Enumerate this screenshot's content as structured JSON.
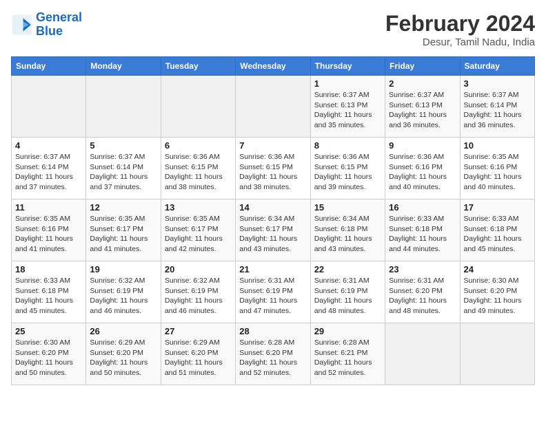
{
  "header": {
    "logo_line1": "General",
    "logo_line2": "Blue",
    "month_year": "February 2024",
    "location": "Desur, Tamil Nadu, India"
  },
  "columns": [
    "Sunday",
    "Monday",
    "Tuesday",
    "Wednesday",
    "Thursday",
    "Friday",
    "Saturday"
  ],
  "weeks": [
    [
      {
        "day": "",
        "info": ""
      },
      {
        "day": "",
        "info": ""
      },
      {
        "day": "",
        "info": ""
      },
      {
        "day": "",
        "info": ""
      },
      {
        "day": "1",
        "info": "Sunrise: 6:37 AM\nSunset: 6:13 PM\nDaylight: 11 hours\nand 35 minutes."
      },
      {
        "day": "2",
        "info": "Sunrise: 6:37 AM\nSunset: 6:13 PM\nDaylight: 11 hours\nand 36 minutes."
      },
      {
        "day": "3",
        "info": "Sunrise: 6:37 AM\nSunset: 6:14 PM\nDaylight: 11 hours\nand 36 minutes."
      }
    ],
    [
      {
        "day": "4",
        "info": "Sunrise: 6:37 AM\nSunset: 6:14 PM\nDaylight: 11 hours\nand 37 minutes."
      },
      {
        "day": "5",
        "info": "Sunrise: 6:37 AM\nSunset: 6:14 PM\nDaylight: 11 hours\nand 37 minutes."
      },
      {
        "day": "6",
        "info": "Sunrise: 6:36 AM\nSunset: 6:15 PM\nDaylight: 11 hours\nand 38 minutes."
      },
      {
        "day": "7",
        "info": "Sunrise: 6:36 AM\nSunset: 6:15 PM\nDaylight: 11 hours\nand 38 minutes."
      },
      {
        "day": "8",
        "info": "Sunrise: 6:36 AM\nSunset: 6:15 PM\nDaylight: 11 hours\nand 39 minutes."
      },
      {
        "day": "9",
        "info": "Sunrise: 6:36 AM\nSunset: 6:16 PM\nDaylight: 11 hours\nand 40 minutes."
      },
      {
        "day": "10",
        "info": "Sunrise: 6:35 AM\nSunset: 6:16 PM\nDaylight: 11 hours\nand 40 minutes."
      }
    ],
    [
      {
        "day": "11",
        "info": "Sunrise: 6:35 AM\nSunset: 6:16 PM\nDaylight: 11 hours\nand 41 minutes."
      },
      {
        "day": "12",
        "info": "Sunrise: 6:35 AM\nSunset: 6:17 PM\nDaylight: 11 hours\nand 41 minutes."
      },
      {
        "day": "13",
        "info": "Sunrise: 6:35 AM\nSunset: 6:17 PM\nDaylight: 11 hours\nand 42 minutes."
      },
      {
        "day": "14",
        "info": "Sunrise: 6:34 AM\nSunset: 6:17 PM\nDaylight: 11 hours\nand 43 minutes."
      },
      {
        "day": "15",
        "info": "Sunrise: 6:34 AM\nSunset: 6:18 PM\nDaylight: 11 hours\nand 43 minutes."
      },
      {
        "day": "16",
        "info": "Sunrise: 6:33 AM\nSunset: 6:18 PM\nDaylight: 11 hours\nand 44 minutes."
      },
      {
        "day": "17",
        "info": "Sunrise: 6:33 AM\nSunset: 6:18 PM\nDaylight: 11 hours\nand 45 minutes."
      }
    ],
    [
      {
        "day": "18",
        "info": "Sunrise: 6:33 AM\nSunset: 6:18 PM\nDaylight: 11 hours\nand 45 minutes."
      },
      {
        "day": "19",
        "info": "Sunrise: 6:32 AM\nSunset: 6:19 PM\nDaylight: 11 hours\nand 46 minutes."
      },
      {
        "day": "20",
        "info": "Sunrise: 6:32 AM\nSunset: 6:19 PM\nDaylight: 11 hours\nand 46 minutes."
      },
      {
        "day": "21",
        "info": "Sunrise: 6:31 AM\nSunset: 6:19 PM\nDaylight: 11 hours\nand 47 minutes."
      },
      {
        "day": "22",
        "info": "Sunrise: 6:31 AM\nSunset: 6:19 PM\nDaylight: 11 hours\nand 48 minutes."
      },
      {
        "day": "23",
        "info": "Sunrise: 6:31 AM\nSunset: 6:20 PM\nDaylight: 11 hours\nand 48 minutes."
      },
      {
        "day": "24",
        "info": "Sunrise: 6:30 AM\nSunset: 6:20 PM\nDaylight: 11 hours\nand 49 minutes."
      }
    ],
    [
      {
        "day": "25",
        "info": "Sunrise: 6:30 AM\nSunset: 6:20 PM\nDaylight: 11 hours\nand 50 minutes."
      },
      {
        "day": "26",
        "info": "Sunrise: 6:29 AM\nSunset: 6:20 PM\nDaylight: 11 hours\nand 50 minutes."
      },
      {
        "day": "27",
        "info": "Sunrise: 6:29 AM\nSunset: 6:20 PM\nDaylight: 11 hours\nand 51 minutes."
      },
      {
        "day": "28",
        "info": "Sunrise: 6:28 AM\nSunset: 6:20 PM\nDaylight: 11 hours\nand 52 minutes."
      },
      {
        "day": "29",
        "info": "Sunrise: 6:28 AM\nSunset: 6:21 PM\nDaylight: 11 hours\nand 52 minutes."
      },
      {
        "day": "",
        "info": ""
      },
      {
        "day": "",
        "info": ""
      }
    ]
  ]
}
